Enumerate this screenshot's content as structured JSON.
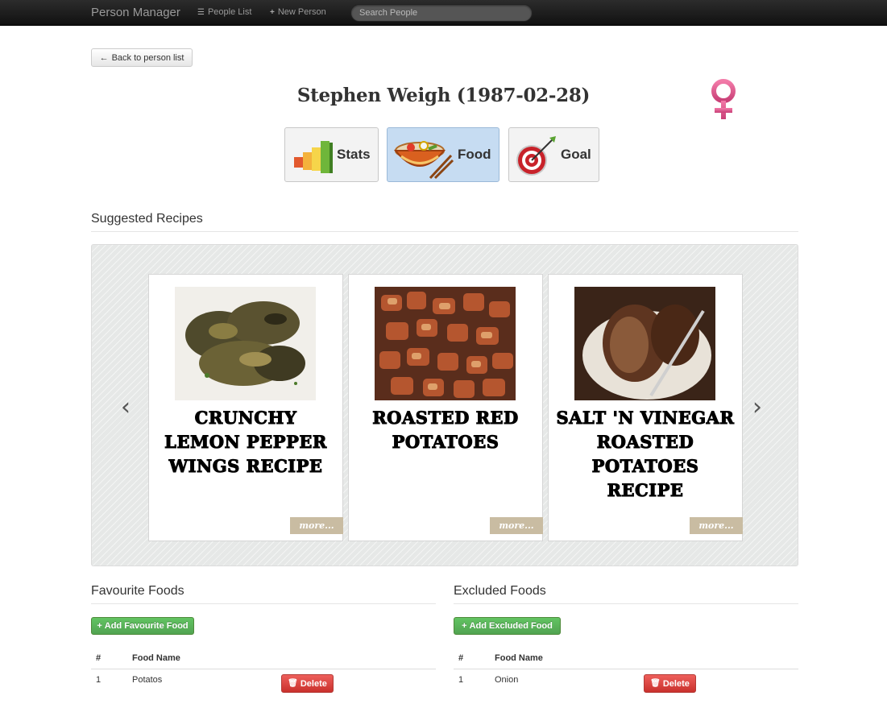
{
  "nav": {
    "brand": "Person Manager",
    "people_list": "People List",
    "new_person": "New Person",
    "search_placeholder": "Search People"
  },
  "back_label": "Back to person list",
  "person": {
    "title": "Stephen Weigh (1987-02-28)",
    "gender_icon": "female-symbol-icon"
  },
  "tabs": [
    {
      "label": "Stats",
      "icon": "bar-chart-icon",
      "active": false
    },
    {
      "label": "Food",
      "icon": "noodle-bowl-icon",
      "active": true
    },
    {
      "label": "Goal",
      "icon": "target-icon",
      "active": false
    }
  ],
  "recipes": {
    "heading": "Suggested Recipes",
    "items": [
      {
        "title": "Crunchy Lemon Pepper Wings Recipe",
        "more": "more..."
      },
      {
        "title": "Roasted Red Potatoes",
        "more": "more..."
      },
      {
        "title": "Salt 'N Vinegar Roasted Potatoes Recipe",
        "more": "more..."
      }
    ]
  },
  "favourites": {
    "heading": "Favourite Foods",
    "add_label": "Add Favourite Food",
    "columns": [
      "#",
      "Food Name"
    ],
    "rows": [
      {
        "num": "1",
        "name": "Potatos",
        "delete": "Delete"
      }
    ]
  },
  "excluded": {
    "heading": "Excluded Foods",
    "add_label": "Add Excluded Food",
    "columns": [
      "#",
      "Food Name"
    ],
    "rows": [
      {
        "num": "1",
        "name": "Onion",
        "delete": "Delete"
      }
    ]
  },
  "colors": {
    "navbar": "#1b1b1b",
    "active_tab": "#c6dcf2",
    "green": "#5bb75b",
    "red": "#da4f49",
    "gender_pink": "#e0608f",
    "more_badge": "#c9bca2"
  }
}
